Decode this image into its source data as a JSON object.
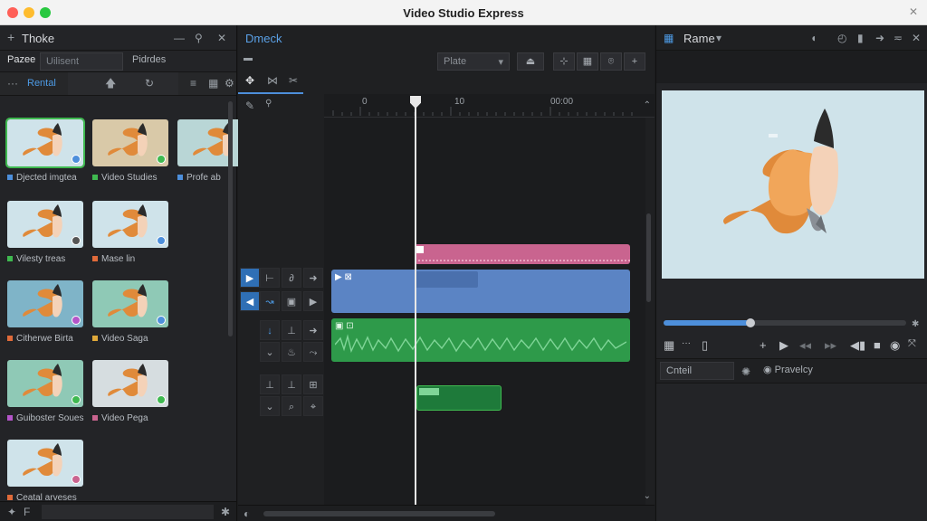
{
  "window": {
    "title": "Video Studio Express"
  },
  "colors": {
    "accent_green": "#3fb950",
    "accent_blue": "#4d8fdb",
    "clip_pink": "#c9648f",
    "clip_blue": "#5b84c4",
    "clip_green": "#2e9a4a"
  },
  "media": {
    "panel_title": "Thoke",
    "tabs": [
      "Pazee",
      "Uilisent",
      "Pidrdes"
    ],
    "filter_label": "Rental",
    "items": [
      {
        "label": "Djected imgtea",
        "marker_color": "#4d8fdb",
        "badge": "#4d8fdb"
      },
      {
        "label": "Video Studies",
        "marker_color": "#3fb950",
        "badge": "#3fb950"
      },
      {
        "label": "Profe ab",
        "marker_color": "#4d8fdb",
        "badge": ""
      },
      {
        "label": "Vilesty treas",
        "marker_color": "#3fb950",
        "badge": "#555"
      },
      {
        "label": "Mase lin",
        "marker_color": "#e06b3a",
        "badge": "#4d8fdb"
      },
      {
        "label": "Citherwe Birta",
        "marker_color": "#e06b3a",
        "badge": "#b455c9"
      },
      {
        "label": "Video Saga",
        "marker_color": "#e0a93a",
        "badge": "#4d8fdb"
      },
      {
        "label": "Guiboster Soues",
        "marker_color": "#b455c9",
        "badge": "#3fb950"
      },
      {
        "label": "Video Pega",
        "marker_color": "#c9648f",
        "badge": "#3fb950"
      },
      {
        "label": "Ceatal arveses",
        "marker_color": "#e06b3a",
        "badge": "#c9648f"
      }
    ]
  },
  "timeline": {
    "panel_title": "Dmeck",
    "zoom_dropdown": "Plate",
    "ruler_labels": [
      "0",
      "10",
      "00:00"
    ]
  },
  "viewer": {
    "panel_title": "Rame",
    "progress": 0.36,
    "name_field": "Cnteil",
    "property_label": "Pravelcy"
  }
}
